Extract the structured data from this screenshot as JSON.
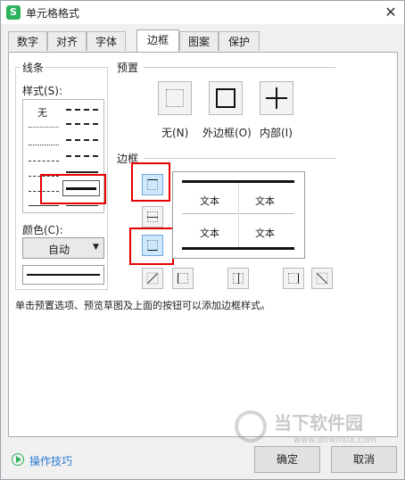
{
  "window": {
    "title": "单元格格式",
    "icon_letter": "S",
    "close_glyph": "✕"
  },
  "tabs": [
    {
      "label": "数字"
    },
    {
      "label": "对齐"
    },
    {
      "label": "字体"
    },
    {
      "label": "边框",
      "active": true
    },
    {
      "label": "图案"
    },
    {
      "label": "保护"
    }
  ],
  "line_group": {
    "title": "线条",
    "style_label": "样式(S):",
    "none_label": "无",
    "color_label": "颜色(C):",
    "color_value": "自动",
    "dropdown_arrow": "▼"
  },
  "presets": {
    "title": "预置",
    "none_label": "无(N)",
    "outline_label": "外边框(O)",
    "inside_label": "内部(I)"
  },
  "border": {
    "title": "边框",
    "preview_text": [
      "文本",
      "文本",
      "文本",
      "文本"
    ]
  },
  "hint": "单击预置选项、预览草图及上面的按钮可以添加边框样式。",
  "footer": {
    "tips_label": "操作技巧",
    "ok_label": "确定",
    "cancel_label": "取消"
  },
  "watermark": {
    "text": "当下软件园",
    "url_text": "www.downxia.com"
  },
  "colors": {
    "accent": "#2db35d",
    "highlight": "#e60000",
    "selected_button": "#cde8ff"
  }
}
